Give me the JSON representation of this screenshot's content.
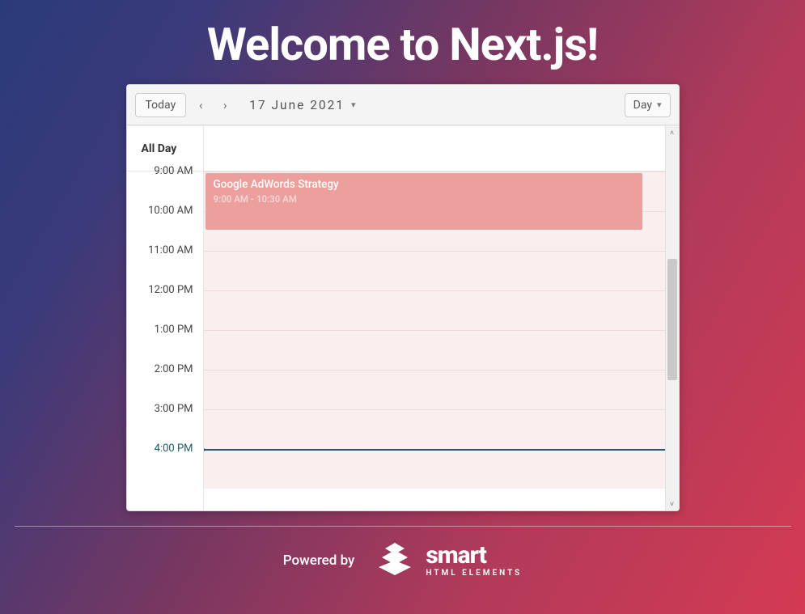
{
  "hero": {
    "title": "Welcome to Next.js!"
  },
  "toolbar": {
    "today_label": "Today",
    "current_date": "17 June 2021",
    "view_label": "Day"
  },
  "scheduler": {
    "allday_label": "All Day",
    "hours": [
      "9:00 AM",
      "10:00 AM",
      "11:00 AM",
      "12:00 PM",
      "1:00 PM",
      "2:00 PM",
      "3:00 PM",
      "4:00 PM"
    ],
    "now_index": 7,
    "events": [
      {
        "title": "Google AdWords Strategy",
        "time_label": "9:00 AM - 10:30 AM",
        "start_slot": 0,
        "span_slots": 1.5
      }
    ]
  },
  "footer": {
    "powered_by": "Powered by",
    "brand_big": "smart",
    "brand_small": "HTML ELEMENTS"
  },
  "colors": {
    "event_bg": "#ec9f9c",
    "grid_bg": "#fbeeee",
    "now_line": "#1d5b6d"
  }
}
